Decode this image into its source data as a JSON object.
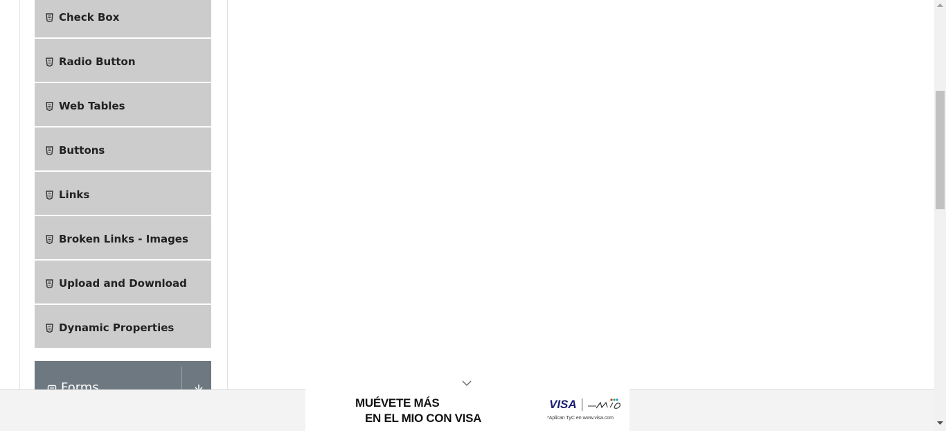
{
  "sidebar": {
    "items": [
      {
        "label": "Check Box",
        "icon": "document-icon"
      },
      {
        "label": "Radio Button",
        "icon": "document-icon"
      },
      {
        "label": "Web Tables",
        "icon": "document-icon"
      },
      {
        "label": "Buttons",
        "icon": "document-icon"
      },
      {
        "label": "Links",
        "icon": "document-icon"
      },
      {
        "label": "Broken Links - Images",
        "icon": "document-icon"
      },
      {
        "label": "Upload and Download",
        "icon": "document-icon"
      },
      {
        "label": "Dynamic Properties",
        "icon": "document-icon"
      }
    ],
    "next_group": {
      "label": "Forms",
      "icon": "form-icon",
      "toggle_icon": "chevron-down-icon"
    }
  },
  "ad": {
    "headline_line1": "MUÉVETE MÁS",
    "headline_line2": "EN EL MIO CON VISA",
    "brand": "VISA",
    "terms": "*Aplican TyC en www.visa.com",
    "collapse_icon": "chevron-down-icon"
  },
  "colors": {
    "menu_item_bg": "#cccccc",
    "group_header_bg": "#6e7880",
    "visa_blue": "#1a1f71"
  }
}
